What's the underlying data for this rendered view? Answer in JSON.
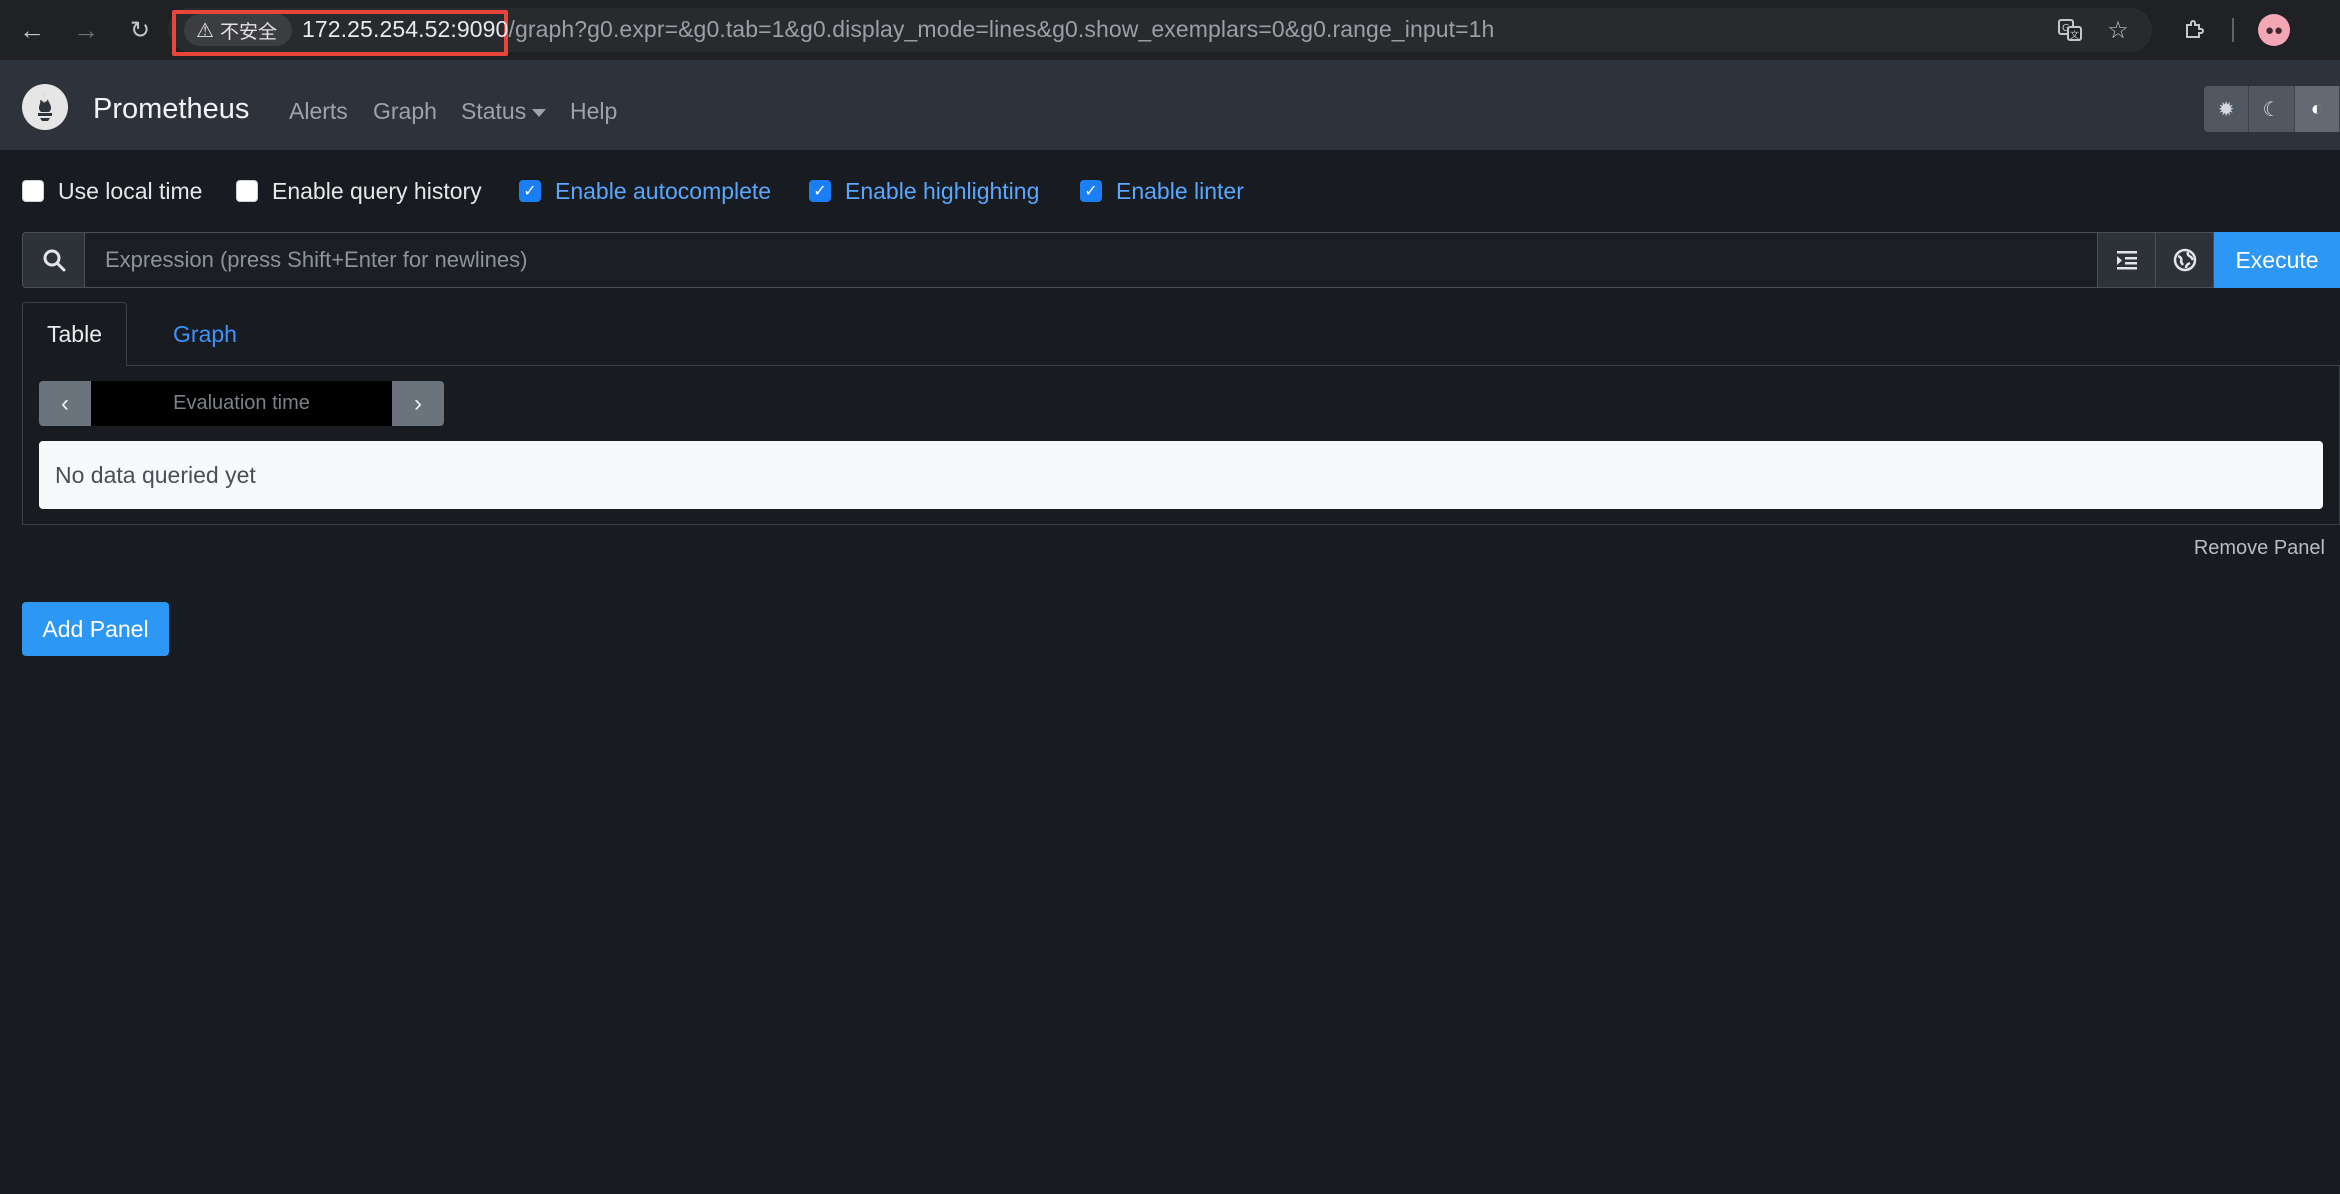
{
  "browser": {
    "security_label": "不安全",
    "url_host": "172.25.254.52:9090",
    "url_path": "/graph?g0.expr=&g0.tab=1&g0.display_mode=lines&g0.show_exemplars=0&g0.range_input=1h"
  },
  "navbar": {
    "brand": "Prometheus",
    "links": {
      "alerts": "Alerts",
      "graph": "Graph",
      "status": "Status",
      "help": "Help"
    }
  },
  "options": {
    "use_local_time": {
      "label": "Use local time",
      "checked": false
    },
    "query_history": {
      "label": "Enable query history",
      "checked": false
    },
    "autocomplete": {
      "label": "Enable autocomplete",
      "checked": true
    },
    "highlighting": {
      "label": "Enable highlighting",
      "checked": true
    },
    "linter": {
      "label": "Enable linter",
      "checked": true
    }
  },
  "expression": {
    "placeholder": "Expression (press Shift+Enter for newlines)",
    "value": "",
    "execute_label": "Execute"
  },
  "panel": {
    "tabs": {
      "table": "Table",
      "graph": "Graph"
    },
    "active_tab": "Table",
    "eval_placeholder": "Evaluation time",
    "no_data": "No data queried yet",
    "remove_label": "Remove Panel"
  },
  "add_panel_label": "Add Panel",
  "colors": {
    "background": "#181b1f",
    "navbar": "#2e323a",
    "accent": "#2c97f5",
    "link": "#3d93ff"
  }
}
